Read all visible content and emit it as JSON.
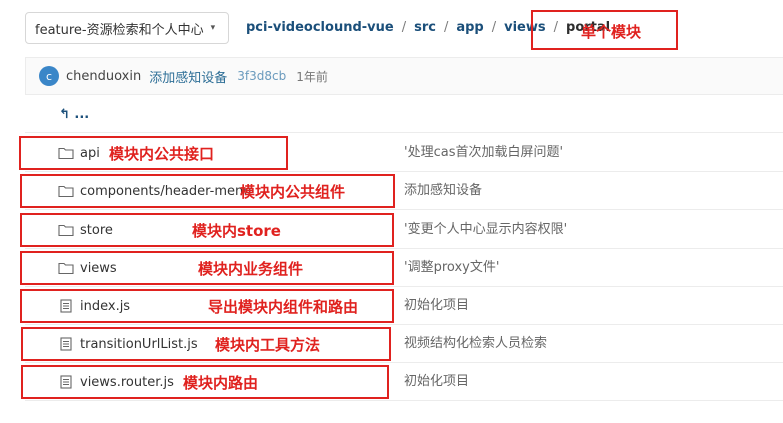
{
  "branch": {
    "label": "feature-资源检索和个人中心",
    "caret": "▾"
  },
  "breadcrumb": [
    {
      "label": "pci-videoclound-vue"
    },
    {
      "label": "src"
    },
    {
      "label": "app"
    },
    {
      "label": "views"
    },
    {
      "label": "portal"
    }
  ],
  "separator": "/",
  "header_annotation": "单个模块",
  "commit": {
    "avatar_letter": "c",
    "author": "chenduoxin",
    "message": "添加感知设备",
    "sha": "3f3d8cb",
    "time": "1年前"
  },
  "up_link": "↰ ...",
  "files": [
    {
      "name": "api",
      "type": "folder",
      "last_commit": "'处理cas首次加载白屏问题'",
      "annotation": "模块内公共接口"
    },
    {
      "name": "components/header-menu",
      "type": "folder",
      "last_commit": "添加感知设备",
      "annotation": "模块内公共组件"
    },
    {
      "name": "store",
      "type": "folder",
      "last_commit": "'变更个人中心显示内容权限'",
      "annotation": "模块内store"
    },
    {
      "name": "views",
      "type": "folder",
      "last_commit": "'调整proxy文件'",
      "annotation": "模块内业务组件"
    },
    {
      "name": "index.js",
      "type": "file",
      "last_commit": "初始化项目",
      "annotation": "导出模块内组件和路由"
    },
    {
      "name": "transitionUrlList.js",
      "type": "file",
      "last_commit": "视频结构化检索人员检索",
      "annotation": "模块内工具方法"
    },
    {
      "name": "views.router.js",
      "type": "file",
      "last_commit": "初始化项目",
      "annotation": "模块内路由"
    }
  ],
  "colors": {
    "annotation": "#e0221f",
    "link": "#1b4f7a",
    "accent": "#3a86c8"
  },
  "icons": {
    "folder": "folder-icon",
    "file": "file-icon",
    "up": "arrow-up-left-icon"
  }
}
